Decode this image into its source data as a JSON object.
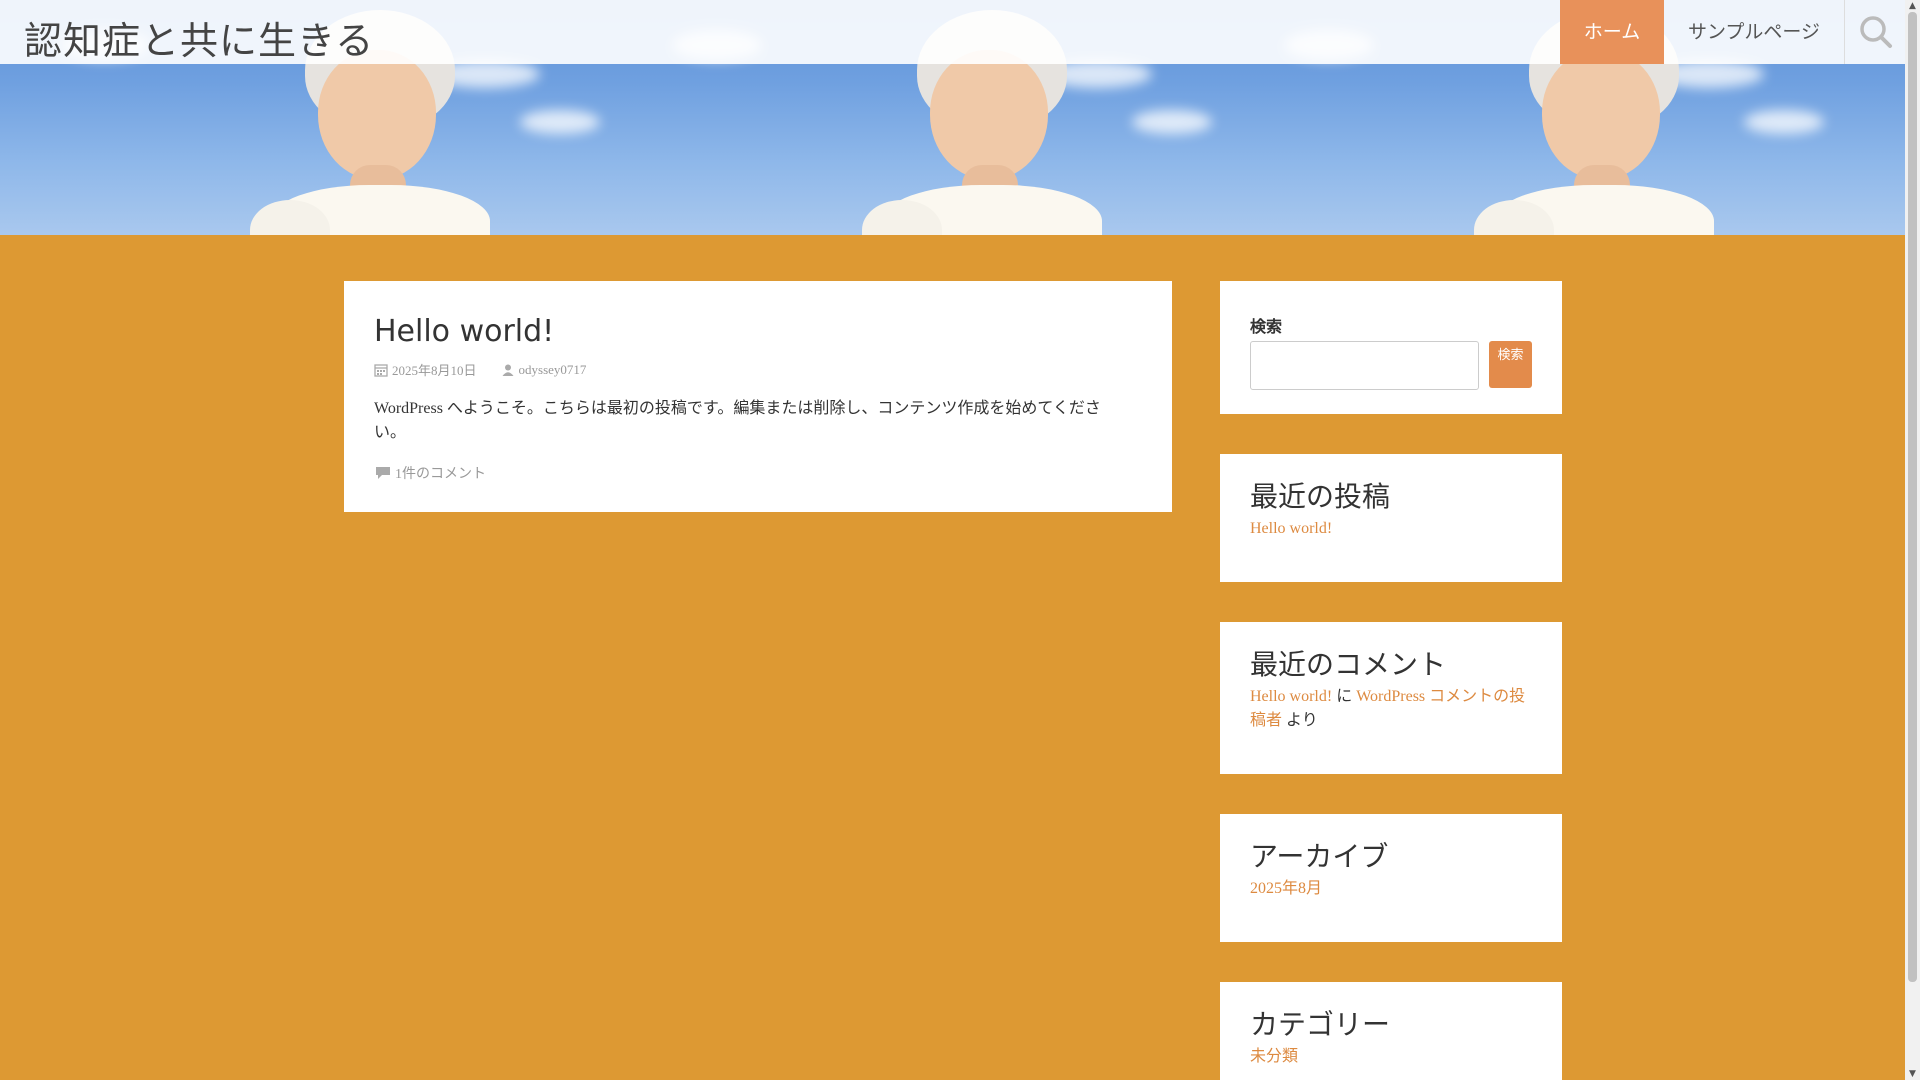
{
  "site": {
    "title": "認知症と共に生きる"
  },
  "nav": {
    "home": "ホーム",
    "sample": "サンプルページ",
    "search_icon": "search-icon"
  },
  "post": {
    "title": "Hello world!",
    "date": "2025年8月10日",
    "author": "odyssey0717",
    "body": "WordPress へようこそ。こちらは最初の投稿です。編集または削除し、コンテンツ作成を始めてください。",
    "comments": "1件のコメント"
  },
  "sidebar": {
    "search": {
      "label": "検索",
      "button": "検索",
      "placeholder": ""
    },
    "recent_posts": {
      "title": "最近の投稿",
      "items": [
        "Hello world!"
      ]
    },
    "recent_comments": {
      "title": "最近のコメント",
      "post_link": "Hello world!",
      "connector": "に",
      "author_link": "WordPress コメントの投稿者",
      "suffix": "より"
    },
    "archives": {
      "title": "アーカイブ",
      "items": [
        "2025年8月"
      ]
    },
    "categories": {
      "title": "カテゴリー",
      "items": [
        "未分類"
      ]
    }
  },
  "colors": {
    "background": "#dd9933",
    "accent": "#e8915a",
    "link": "#dd8a40"
  }
}
